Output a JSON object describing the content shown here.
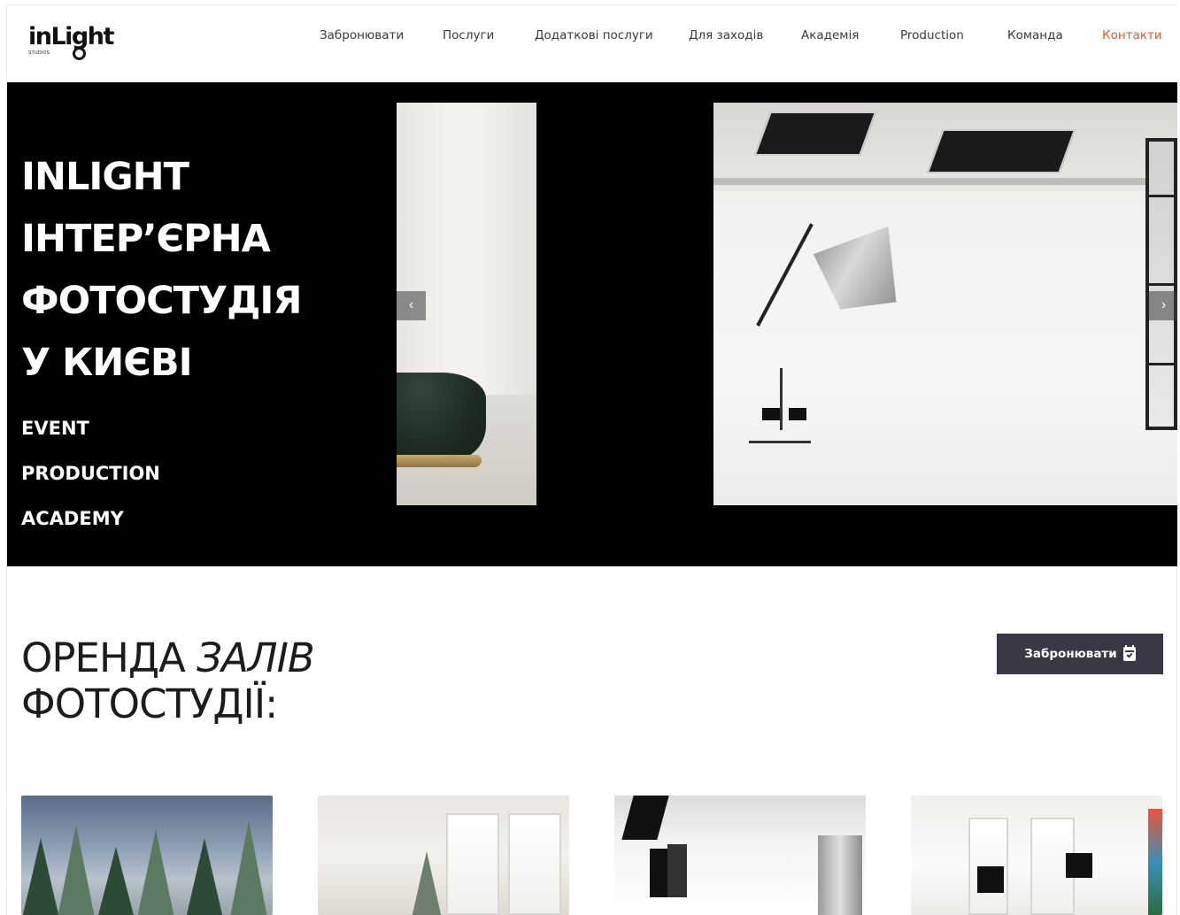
{
  "header": {
    "logo_text": "inLight",
    "logo_sub": "STUDIOS",
    "nav": [
      {
        "label": "Забронювати"
      },
      {
        "label": "Послуги"
      },
      {
        "label": "Додаткові послуги"
      },
      {
        "label": "Для заходів"
      },
      {
        "label": "Академія"
      },
      {
        "label": "Production"
      },
      {
        "label": "Команда"
      },
      {
        "label": "Контакти",
        "active": true
      }
    ],
    "active_color": "#e8562a"
  },
  "hero": {
    "title_lines": [
      "INLIGHT",
      "ІНТЕР’ЄРНА",
      "ФОТОСТУДІЯ",
      "У КИЄВІ"
    ],
    "links": [
      "EVENT",
      "PRODUCTION",
      "ACADEMY"
    ],
    "prev_arrow": "‹",
    "next_arrow": "›",
    "prev_icon": "chevron-left-icon",
    "next_icon": "chevron-right-icon",
    "background": "#000000"
  },
  "section": {
    "title_line1_normal": "ОРЕНДА",
    "title_line1_italic": "ЗАЛІВ",
    "title_line2": "ФОТОСТУДІЇ:",
    "book_button": "Забронювати",
    "book_icon": "calendar-check-icon",
    "button_color": "#3a3846"
  },
  "studio_cards": [
    {
      "image": "winter-forest-set"
    },
    {
      "image": "white-interior-with-christmas-tree"
    },
    {
      "image": "white-cyclorama-with-softboxes"
    },
    {
      "image": "white-loft-with-lighting"
    }
  ]
}
